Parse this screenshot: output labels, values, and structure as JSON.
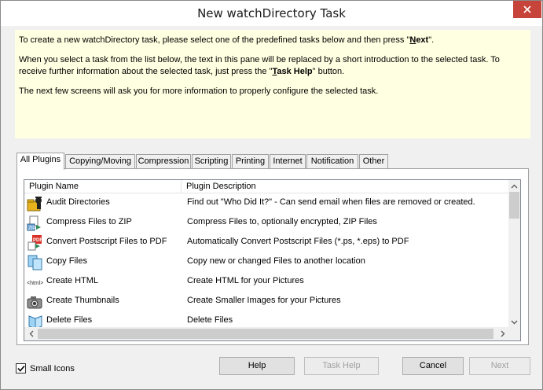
{
  "window": {
    "title": "New watchDirectory Task"
  },
  "intro": {
    "p1_pre": "To create a new watchDirectory task, please select one of the predefined tasks below and then press \"",
    "p1_key_hotkey": "N",
    "p1_key_rest": "ext",
    "p1_post": "\".",
    "p2_pre": "When you select a task from the list below, the text in this pane will be replaced by a short introduction to the selected task. To receive further information about the selected task, just press the \"",
    "p2_key_hotkey": "T",
    "p2_key_rest": "ask Help",
    "p2_post": "\" button.",
    "p3": "The next few screens will ask you for more information to properly configure the selected task."
  },
  "tabs": [
    {
      "label": "All Plugins",
      "active": true
    },
    {
      "label": "Copying/Moving"
    },
    {
      "label": "Compression"
    },
    {
      "label": "Scripting"
    },
    {
      "label": "Printing"
    },
    {
      "label": "Internet"
    },
    {
      "label": "Notification"
    },
    {
      "label": "Other"
    }
  ],
  "list": {
    "columns": [
      "Plugin Name",
      "Plugin Description"
    ],
    "rows": [
      {
        "icon": "audit-icon",
        "name": "Audit Directories",
        "desc": "Find out \"Who Did It?\" - Can send email when files are removed or created."
      },
      {
        "icon": "zip-icon",
        "name": "Compress Files to ZIP",
        "desc": "Compress Files to, optionally encrypted, ZIP Files"
      },
      {
        "icon": "pdf-icon",
        "name": "Convert Postscript Files to PDF",
        "desc": "Automatically Convert Postscript Files (*.ps, *.eps) to PDF"
      },
      {
        "icon": "copy-files-icon",
        "name": "Copy Files",
        "desc": "Copy new or changed Files to another location"
      },
      {
        "icon": "html-icon",
        "name": "Create HTML",
        "desc": "Create HTML for your Pictures"
      },
      {
        "icon": "camera-icon",
        "name": "Create Thumbnails",
        "desc": "Create Smaller Images for your Pictures"
      },
      {
        "icon": "delete-files-icon",
        "name": "Delete Files",
        "desc": "Delete Files"
      }
    ]
  },
  "footer": {
    "small_icons_label": "Small Icons",
    "small_icons_checked": true,
    "help": "Help",
    "task_help": "Task Help",
    "cancel": "Cancel",
    "next": "Next"
  }
}
